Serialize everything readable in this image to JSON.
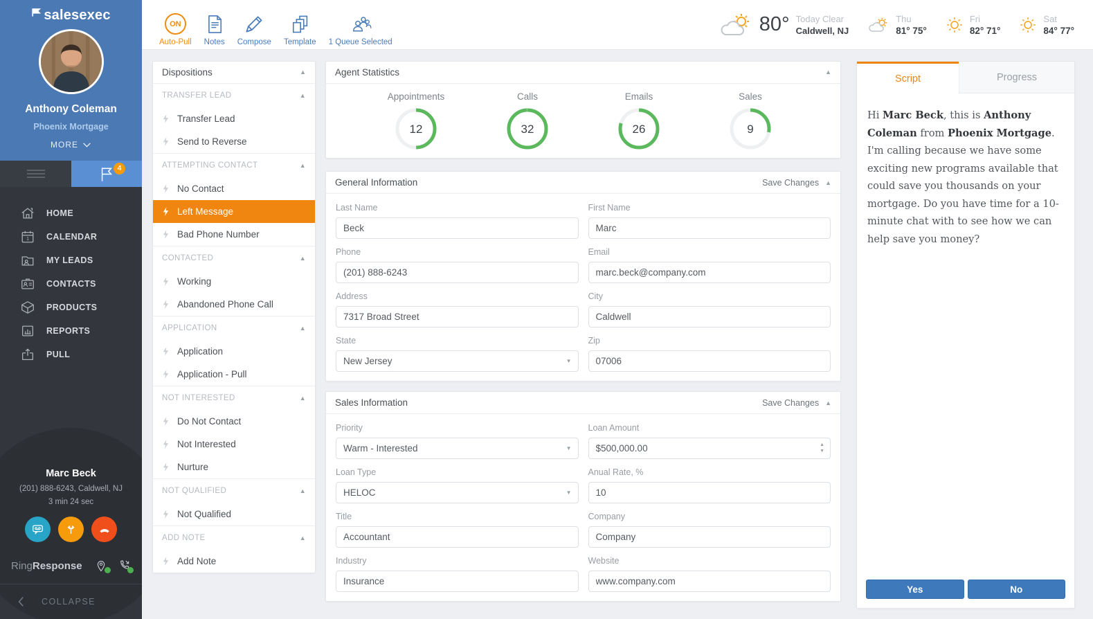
{
  "app": {
    "logo_text": "salesexec"
  },
  "sidebar": {
    "user": {
      "name": "Anthony Coleman",
      "company": "Phoenix Mortgage",
      "more_label": "MORE"
    },
    "flag_badge": "4",
    "nav": [
      {
        "label": "HOME"
      },
      {
        "label": "CALENDAR"
      },
      {
        "label": "MY LEADS"
      },
      {
        "label": "CONTACTS"
      },
      {
        "label": "PRODUCTS"
      },
      {
        "label": "REPORTS"
      },
      {
        "label": "PULL"
      }
    ],
    "call": {
      "contact_name": "Marc Beck",
      "contact_details": "(201) 888-6243, Caldwell, NJ",
      "duration": "3 min 24 sec"
    },
    "ring_response": {
      "brand_regular": "Ring",
      "brand_bold": "Response"
    },
    "collapse_label": "COLLAPSE"
  },
  "topbar": {
    "auto_pull": {
      "state": "ON",
      "label": "Auto-Pull"
    },
    "tools": [
      {
        "label": "Notes"
      },
      {
        "label": "Compose"
      },
      {
        "label": "Template"
      },
      {
        "label": "1 Queue Selected"
      }
    ],
    "weather": {
      "current": {
        "temp": "80°",
        "condition": "Today Clear",
        "location": "Caldwell, NJ"
      },
      "forecast": [
        {
          "day": "Thu",
          "temps": "81° 75°",
          "icon": "sun-cloud"
        },
        {
          "day": "Fri",
          "temps": "82° 71°",
          "icon": "sun"
        },
        {
          "day": "Sat",
          "temps": "84° 77°",
          "icon": "sun"
        }
      ]
    }
  },
  "dispositions": {
    "title": "Dispositions",
    "sections": [
      {
        "label": "TRANSFER LEAD",
        "items": [
          {
            "label": "Transfer Lead"
          },
          {
            "label": "Send to Reverse"
          }
        ]
      },
      {
        "label": "ATTEMPTING CONTACT",
        "items": [
          {
            "label": "No Contact"
          },
          {
            "label": "Left Message",
            "selected": true
          },
          {
            "label": "Bad Phone Number"
          }
        ]
      },
      {
        "label": "CONTACTED",
        "items": [
          {
            "label": "Working"
          },
          {
            "label": "Abandoned Phone Call"
          }
        ]
      },
      {
        "label": "APPLICATION",
        "items": [
          {
            "label": "Application"
          },
          {
            "label": "Application - Pull"
          }
        ]
      },
      {
        "label": "NOT INTERESTED",
        "items": [
          {
            "label": "Do Not Contact"
          },
          {
            "label": "Not Interested"
          },
          {
            "label": "Nurture"
          }
        ]
      },
      {
        "label": "NOT QUALIFIED",
        "items": [
          {
            "label": "Not Qualified"
          }
        ]
      },
      {
        "label": "ADD NOTE",
        "items": [
          {
            "label": "Add Note"
          }
        ]
      }
    ]
  },
  "stats": {
    "title": "Agent Statistics",
    "ring_color": "#5cb85c",
    "items": [
      {
        "label": "Appointments",
        "value": "12",
        "percent": 50
      },
      {
        "label": "Calls",
        "value": "32",
        "percent": 100
      },
      {
        "label": "Emails",
        "value": "26",
        "percent": 80
      },
      {
        "label": "Sales",
        "value": "9",
        "percent": 28
      }
    ]
  },
  "general_info": {
    "title": "General Information",
    "save_label": "Save Changes",
    "fields": {
      "last_name": {
        "label": "Last Name",
        "value": "Beck"
      },
      "first_name": {
        "label": "First Name",
        "value": "Marc"
      },
      "phone": {
        "label": "Phone",
        "value": "(201) 888-6243"
      },
      "email": {
        "label": "Email",
        "value": "marc.beck@company.com"
      },
      "address": {
        "label": "Address",
        "value": "7317 Broad Street"
      },
      "city": {
        "label": "City",
        "value": "Caldwell"
      },
      "state": {
        "label": "State",
        "value": "New Jersey"
      },
      "zip": {
        "label": "Zip",
        "value": "07006"
      }
    }
  },
  "sales_info": {
    "title": "Sales Information",
    "save_label": "Save Changes",
    "fields": {
      "priority": {
        "label": "Priority",
        "value": "Warm - Interested"
      },
      "loan_amount": {
        "label": "Loan Amount",
        "value": "$500,000.00"
      },
      "loan_type": {
        "label": "Loan Type",
        "value": "HELOC"
      },
      "annual_rate": {
        "label": "Anual Rate, %",
        "value": "10"
      },
      "title": {
        "label": "Title",
        "value": "Accountant"
      },
      "company": {
        "label": "Company",
        "value": "Company"
      },
      "industry": {
        "label": "Industry",
        "value": "Insurance"
      },
      "website": {
        "label": "Website",
        "value": "www.company.com"
      }
    }
  },
  "script_panel": {
    "tabs": [
      {
        "label": "Script"
      },
      {
        "label": "Progress"
      }
    ],
    "script_parts": [
      "Hi ",
      "Marc Beck",
      ", this is ",
      "Anthony Coleman",
      " from ",
      "Phoenix Mortgage",
      ". I'm calling because we have some exciting new programs available that could save you thousands on your mortgage. Do you have time for a 10-minute chat with to see how we can help save you money?"
    ],
    "yes_label": "Yes",
    "no_label": "No"
  },
  "colors": {
    "accent_orange": "#f0860f",
    "sidebar_blue": "#4b79b4",
    "sidebar_dark": "#33373d",
    "link_blue": "#4a7cba",
    "button_blue": "#3d79bb",
    "ring_green": "#5cb85c"
  }
}
